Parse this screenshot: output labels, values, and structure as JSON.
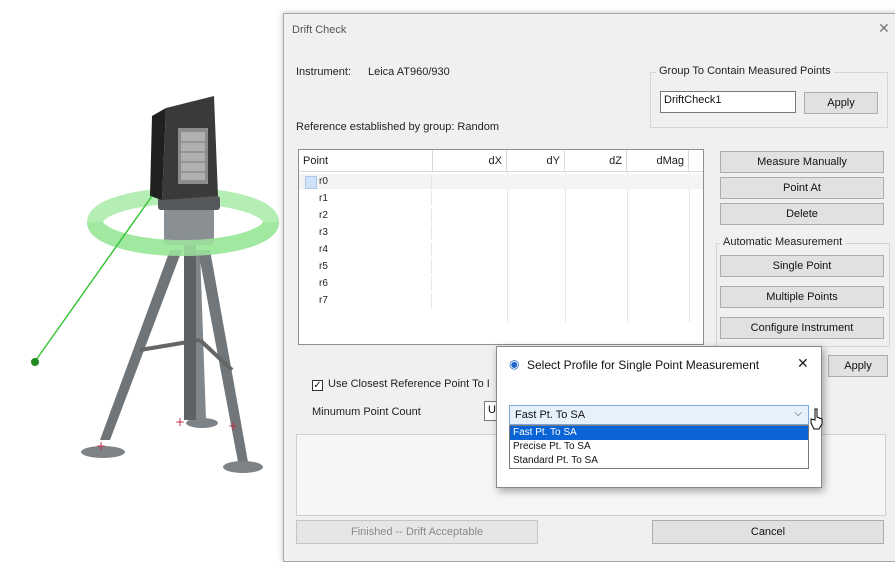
{
  "dialog": {
    "title": "Drift Check",
    "close_glyph": "✕",
    "instrument_label": "Instrument:",
    "instrument_value": "Leica AT960/930",
    "reference_text": "Reference established by group: Random",
    "group_box_title": "Group To Contain Measured Points",
    "group_value": "DriftCheck1",
    "apply_label": "Apply",
    "apply2_label": "Apply",
    "table": {
      "columns": [
        "Point",
        "dX",
        "dY",
        "dZ",
        "dMag"
      ],
      "rows": [
        "r0",
        "r1",
        "r2",
        "r3",
        "r4",
        "r5",
        "r6",
        "r7"
      ]
    },
    "buttons": {
      "measure_manually": "Measure Manually",
      "point_at": "Point At",
      "delete": "Delete",
      "single_point": "Single Point",
      "multiple_points": "Multiple Points",
      "configure_instrument": "Configure Instrument",
      "finished": "Finished -- Drift Acceptable",
      "cancel": "Cancel"
    },
    "auto_group_title": "Automatic Measurement",
    "closest_checkbox_label": "Use Closest Reference Point To I",
    "closest_checkbox_glyph": "✓",
    "min_point_count_label": "Minumum Point Count",
    "min_point_count_value": "U"
  },
  "popup": {
    "title": "Select Profile for Single Point Measurement",
    "close_glyph": "✕",
    "icon": "target-icon",
    "selected": "Fast Pt. To SA",
    "options": [
      "Fast Pt. To SA",
      "Precise Pt. To SA",
      "Standard Pt. To SA"
    ],
    "highlighted_index": 0
  },
  "colors": {
    "accent": "#0a64d6",
    "ring": "#9ee89e",
    "beam": "#3cc43c"
  }
}
